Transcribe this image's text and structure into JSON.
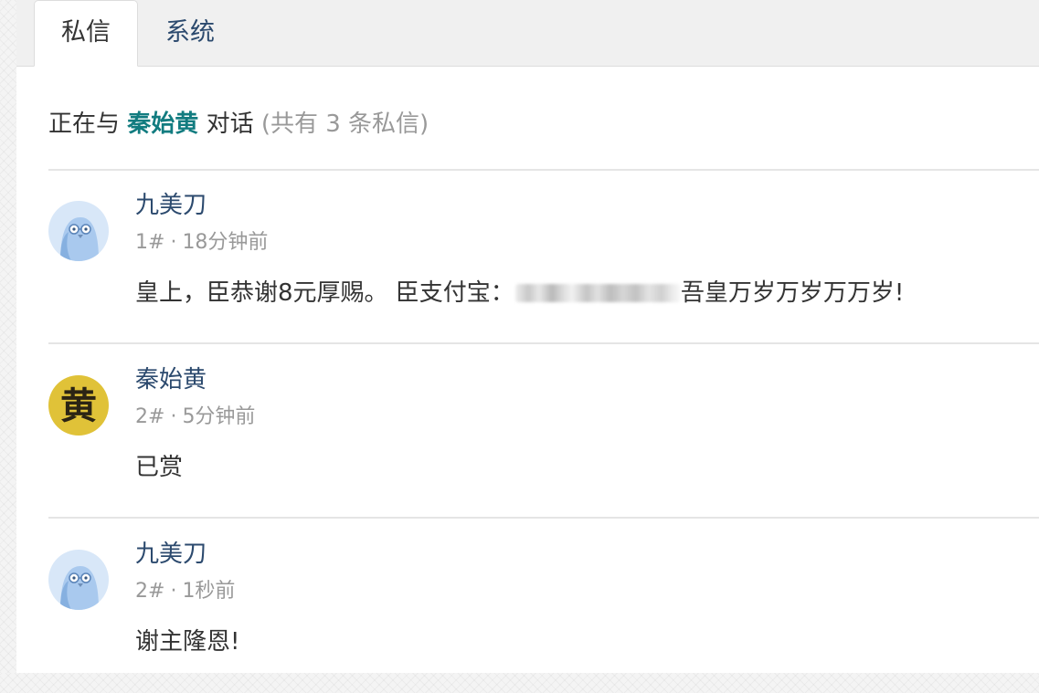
{
  "tabs": [
    {
      "label": "私信",
      "active": true
    },
    {
      "label": "系统",
      "active": false
    }
  ],
  "conversation": {
    "prefix": "正在与",
    "partner": "秦始黄",
    "suffix": "对话",
    "count_text": "(共有 3 条私信)"
  },
  "messages": [
    {
      "author": "九美刀",
      "avatar": "bird-avatar",
      "index": "1#",
      "separator": "·",
      "time": "18分钟前",
      "text_before": "皇上，臣恭谢8元厚赐。 臣支付宝：",
      "text_after": "吾皇万岁万岁万万岁!"
    },
    {
      "author": "秦始黄",
      "avatar": "huang-avatar",
      "avatar_glyph": "黄",
      "index": "2#",
      "separator": "·",
      "time": "5分钟前",
      "text": "已赏"
    },
    {
      "author": "九美刀",
      "avatar": "bird-avatar",
      "index": "2#",
      "separator": "·",
      "time": "1秒前",
      "text": "谢主隆恩!"
    }
  ],
  "colors": {
    "partner_name": "#127c80",
    "author_name": "#2c4a6e",
    "muted_text": "#999999",
    "body_text": "#333333",
    "huang_avatar_bg": "#e0c238",
    "bird_avatar_bg": "#d8e7f8"
  }
}
